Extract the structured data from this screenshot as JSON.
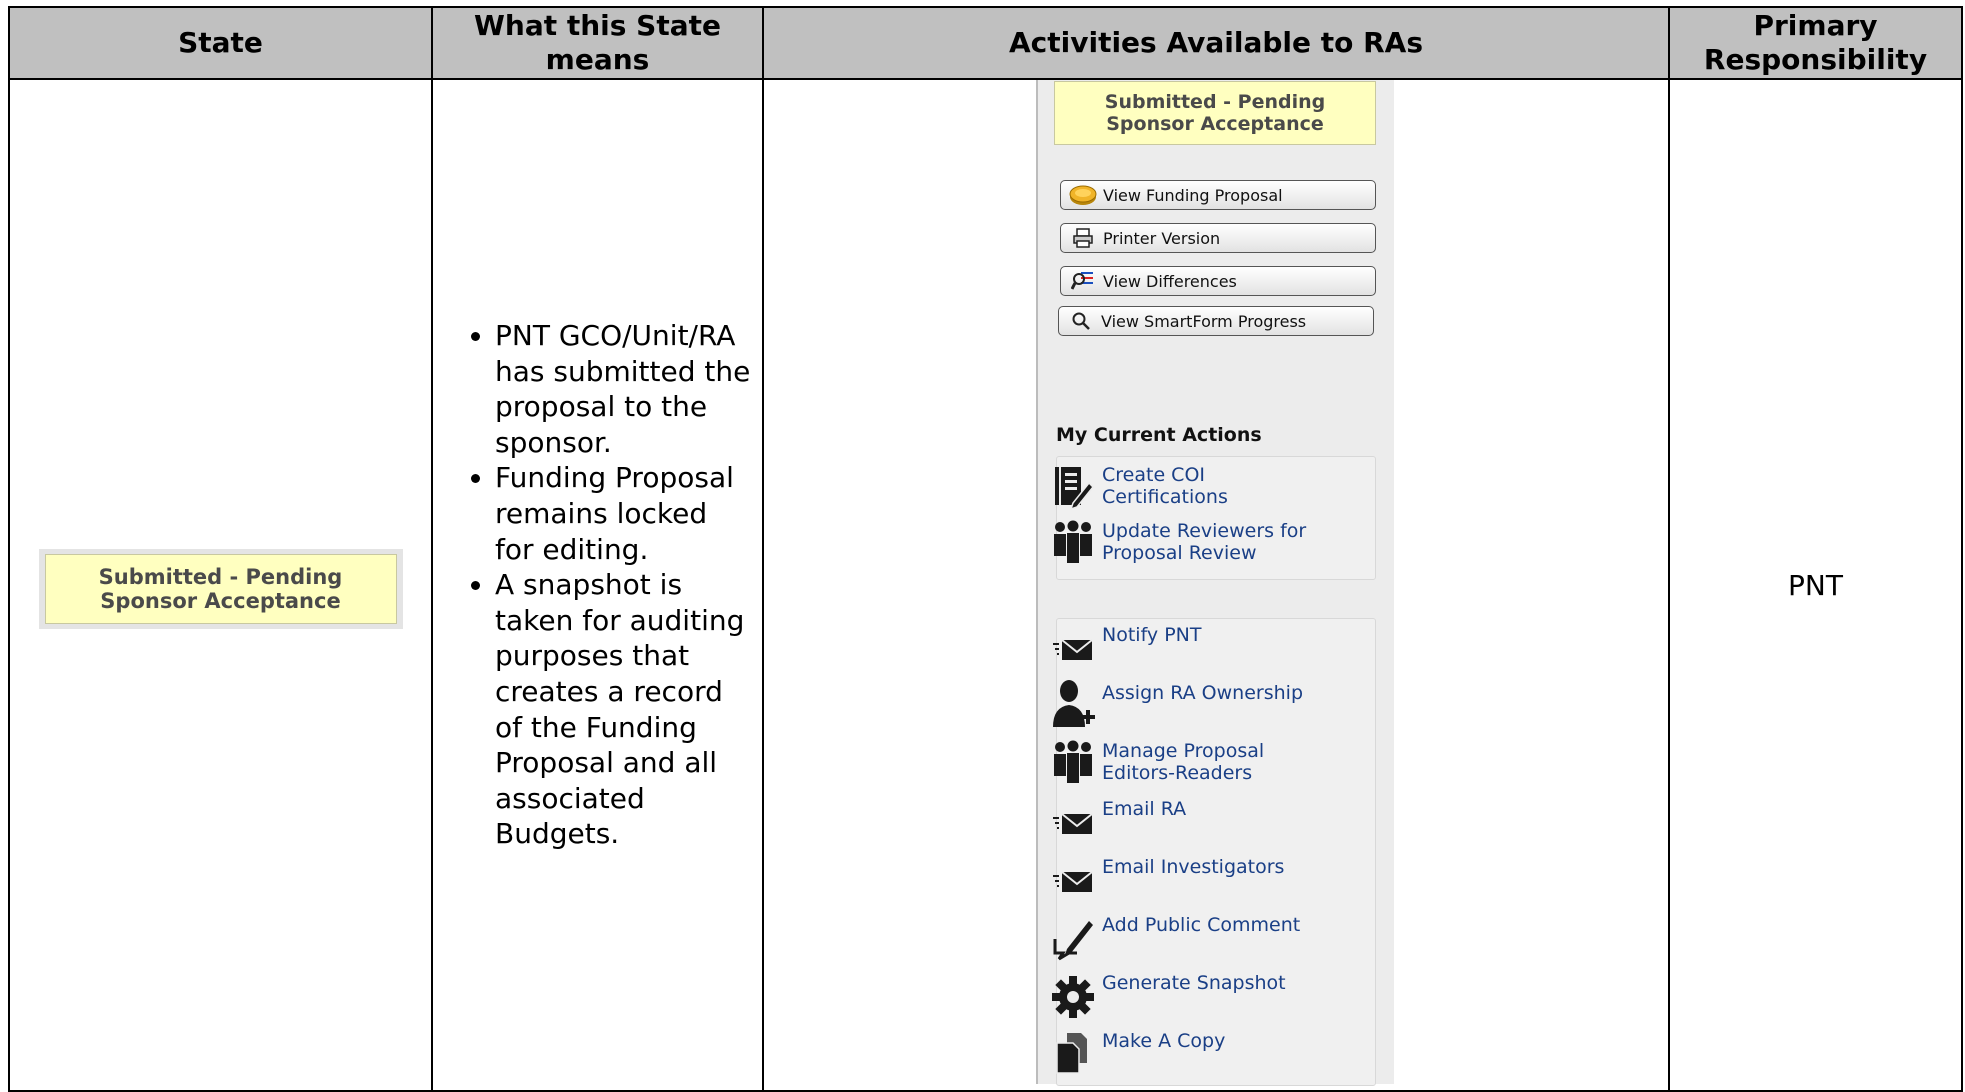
{
  "headers": {
    "state": "State",
    "means": "What this State means",
    "activities": "Activities Available to RAs",
    "responsibility": "Primary Responsibility"
  },
  "row": {
    "state_badge": {
      "line1": "Submitted - Pending",
      "line2": "Sponsor Acceptance"
    },
    "means_bullets": [
      "PNT GCO/Unit/RA has submitted the proposal to the sponsor.",
      "Funding Proposal remains locked for editing.",
      "A snapshot is taken for auditing purposes that creates a record of the Funding Proposal and all associated Budgets."
    ],
    "panel": {
      "state_badge": {
        "line1": "Submitted - Pending",
        "line2": "Sponsor Acceptance"
      },
      "buttons": [
        {
          "label": "View Funding Proposal",
          "icon": "coins-icon"
        },
        {
          "label": "Printer Version",
          "icon": "printer-icon"
        },
        {
          "label": "View Differences",
          "icon": "differences-icon"
        },
        {
          "label": "View SmartForm Progress",
          "icon": "magnifier-icon"
        }
      ],
      "section_title": "My Current Actions",
      "actions_group1": [
        {
          "label": "Create COI Certifications",
          "icon": "certificate-edit-icon"
        },
        {
          "label": "Update Reviewers for Proposal Review",
          "icon": "group-icon"
        }
      ],
      "actions_group2": [
        {
          "label": "Notify PNT",
          "icon": "mail-send-icon"
        },
        {
          "label": "Assign RA Ownership",
          "icon": "add-user-icon"
        },
        {
          "label": "Manage Proposal Editors-Readers",
          "icon": "group-icon"
        },
        {
          "label": "Email RA",
          "icon": "mail-send-icon"
        },
        {
          "label": "Email Investigators",
          "icon": "mail-send-icon"
        },
        {
          "label": "Add Public Comment",
          "icon": "comment-pen-icon"
        },
        {
          "label": "Generate Snapshot",
          "icon": "gear-icon"
        },
        {
          "label": "Make A Copy",
          "icon": "copy-icon"
        }
      ]
    },
    "responsibility": "PNT"
  },
  "colors": {
    "header_bg": "#c0c0c0",
    "badge_bg": "#ffffc0",
    "link": "#1a3f86",
    "panel_bg": "#ececec"
  }
}
